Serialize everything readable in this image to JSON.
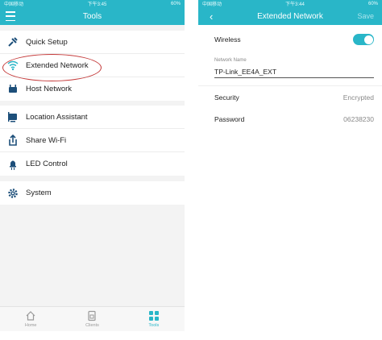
{
  "colors": {
    "accent": "#29b6c8",
    "highlight_circle": "#c43a3a"
  },
  "left": {
    "status": {
      "carrier": "中国移动",
      "time": "下午3:45",
      "battery": "60%"
    },
    "header": {
      "title": "Tools",
      "menu_icon": "hamburger-icon"
    },
    "groups": [
      [
        {
          "label": "Quick Setup",
          "icon": "quick-setup-icon"
        },
        {
          "label": "Extended Network",
          "icon": "wifi-icon"
        },
        {
          "label": "Host Network",
          "icon": "host-network-icon"
        }
      ],
      [
        {
          "label": "Location Assistant",
          "icon": "location-assistant-icon"
        },
        {
          "label": "Share Wi-Fi",
          "icon": "share-icon"
        },
        {
          "label": "LED Control",
          "icon": "led-icon"
        }
      ],
      [
        {
          "label": "System",
          "icon": "gear-icon"
        }
      ]
    ],
    "tabs": [
      {
        "label": "Home",
        "icon": "home-icon",
        "active": false
      },
      {
        "label": "Clients",
        "icon": "clients-icon",
        "active": false
      },
      {
        "label": "Tools",
        "icon": "tools-icon",
        "active": true
      }
    ]
  },
  "right": {
    "status": {
      "carrier": "中国移动",
      "time": "下午3:44",
      "battery": "60%"
    },
    "header": {
      "title": "Extended Network",
      "save_label": "Save",
      "back_icon": "back-chevron-icon"
    },
    "wireless_label": "Wireless",
    "wireless_on": true,
    "network_name_label": "Network Name",
    "network_name_value": "TP-Link_EE4A_EXT",
    "security_label": "Security",
    "security_value": "Encrypted",
    "password_label": "Password",
    "password_value": "06238230"
  }
}
